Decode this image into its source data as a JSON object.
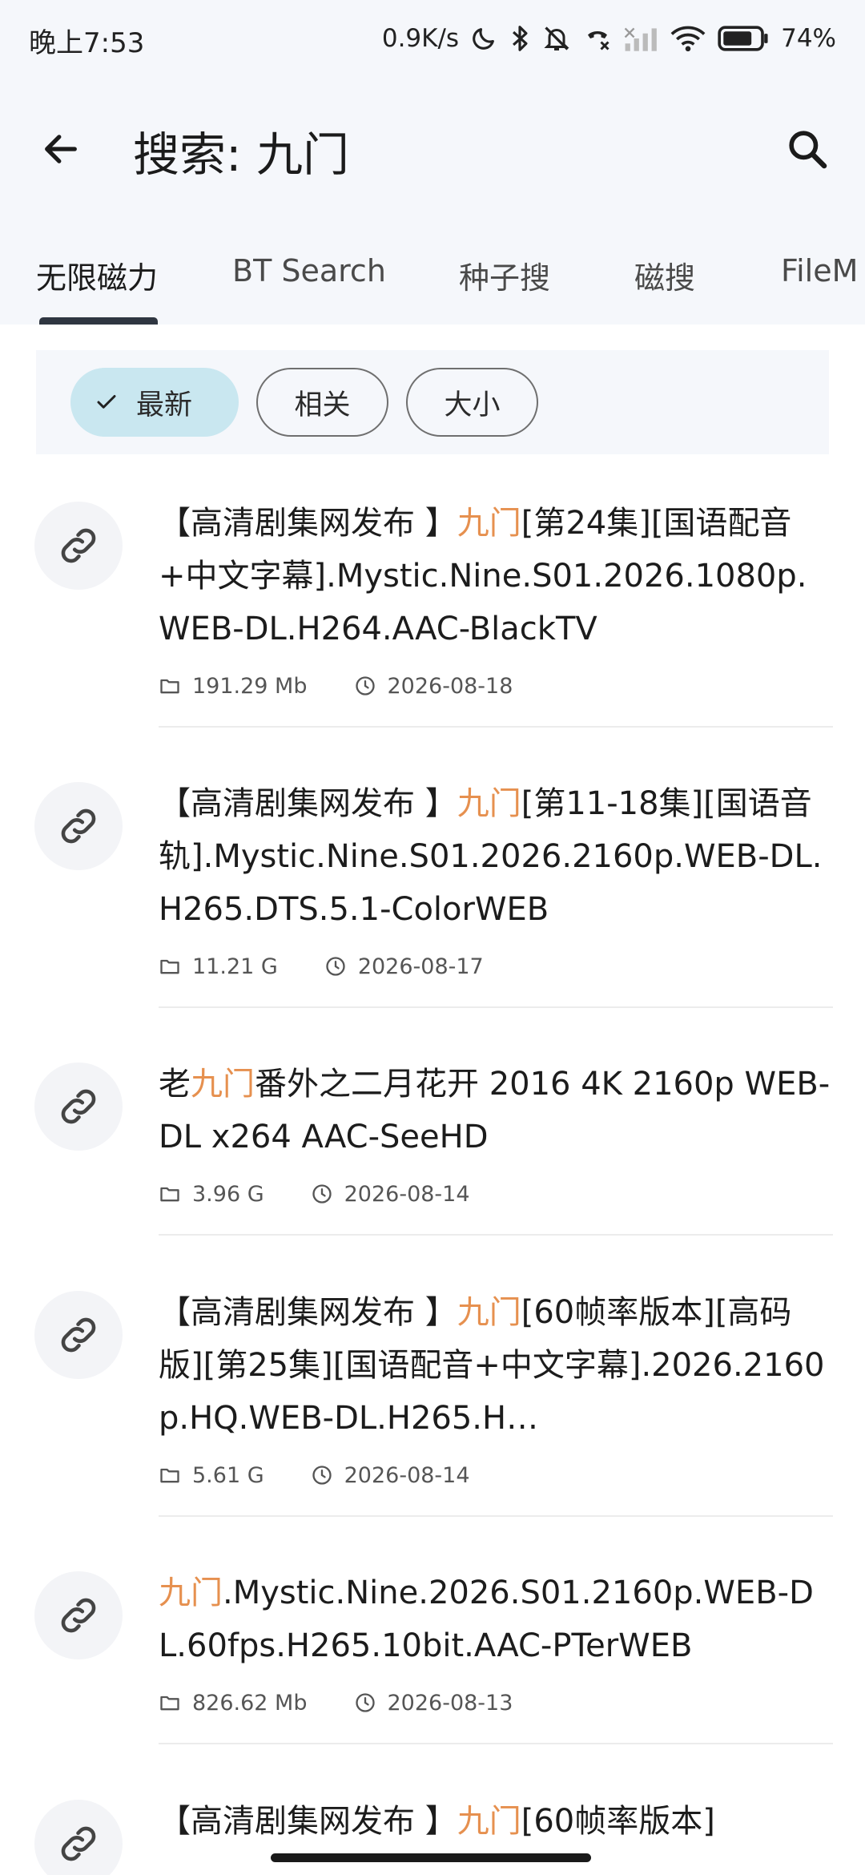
{
  "status_bar": {
    "time": "晚上7:53",
    "network_speed": "0.9K/s",
    "battery": "74%",
    "icons": [
      "moon-icon",
      "bluetooth-icon",
      "bell-off-icon",
      "phone-off-icon",
      "signal-icon",
      "wifi-icon",
      "battery-icon"
    ]
  },
  "header": {
    "title": "搜索: 九门",
    "back_icon": "arrow-left-icon",
    "search_icon": "search-icon"
  },
  "tabs": [
    {
      "label": "无限磁力",
      "active": true
    },
    {
      "label": "BT Search",
      "active": false
    },
    {
      "label": "种子搜",
      "active": false
    },
    {
      "label": "磁搜",
      "active": false
    },
    {
      "label": "FileM",
      "active": false
    }
  ],
  "sort": {
    "options": [
      {
        "label": "最新",
        "selected": true
      },
      {
        "label": "相关",
        "selected": false
      },
      {
        "label": "大小",
        "selected": false
      }
    ]
  },
  "colors": {
    "highlight": "#e6904f",
    "chip_selected": "#c9e7f0",
    "tab_indicator": "#2f3641"
  },
  "results": [
    {
      "title_pre": "【高清剧集网发布 】",
      "title_hl": "九门",
      "title_post": "[第24集][国语配音+中文字幕].Mystic.Nine.S01.2026.1080p.WEB-DL.H264.AAC-BlackTV",
      "size": "191.29 Mb",
      "date": "2026-08-18"
    },
    {
      "title_pre": "【高清剧集网发布 】",
      "title_hl": "九门",
      "title_post": "[第11-18集][国语音轨].Mystic.Nine.S01.2026.2160p.WEB-DL.H265.DTS.5.1-ColorWEB",
      "size": "11.21 G",
      "date": "2026-08-17"
    },
    {
      "title_pre": "老",
      "title_hl": "九门",
      "title_post": "番外之二月花开 2016 4K 2160p WEB-DL x264 AAC-SeeHD",
      "size": "3.96 G",
      "date": "2026-08-14"
    },
    {
      "title_pre": "【高清剧集网发布 】",
      "title_hl": "九门",
      "title_post": "[60帧率版本][高码版][第25集][国语配音+中文字幕].2026.2160p.HQ.WEB-DL.H265.H…",
      "size": "5.61 G",
      "date": "2026-08-14"
    },
    {
      "title_pre": "",
      "title_hl": "九门",
      "title_post": ".Mystic.Nine.2026.S01.2160p.WEB-DL.60fps.H265.10bit.AAC-PTerWEB",
      "size": "826.62 Mb",
      "date": "2026-08-13"
    },
    {
      "title_pre": "【高清剧集网发布 】",
      "title_hl": "九门",
      "title_post": "[60帧率版本]",
      "size": "",
      "date": ""
    }
  ]
}
